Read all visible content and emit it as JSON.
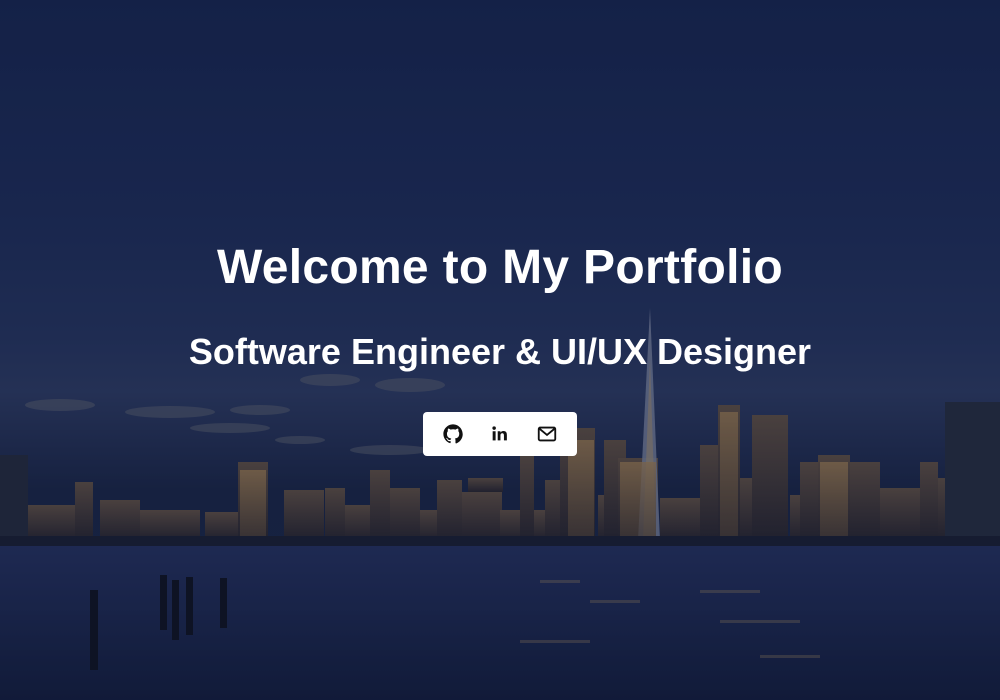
{
  "hero": {
    "title": "Welcome to My Portfolio",
    "subtitle": "Software Engineer & UI/UX Designer"
  },
  "social": {
    "links": [
      {
        "icon": "github-icon"
      },
      {
        "icon": "linkedin-icon"
      },
      {
        "icon": "mail-icon"
      }
    ]
  },
  "colors": {
    "overlay": "#0a122d",
    "text": "#ffffff",
    "social_bar_bg": "#ffffff",
    "icon": "#111111"
  }
}
